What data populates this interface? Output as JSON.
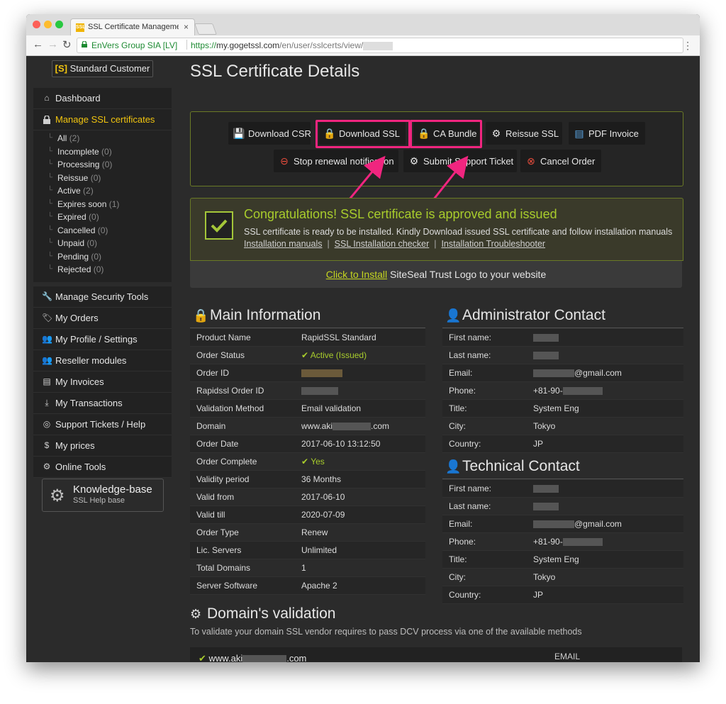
{
  "browser": {
    "tab_title": "SSL Certificate Management S",
    "tab_close": "×",
    "favicon": "SSL",
    "org": "EnVers Group SIA [LV]",
    "url_scheme": "https://",
    "url_host": "my.gogetssl.com",
    "url_path": "/en/user/sslcerts/view/",
    "back": "←",
    "forward": "→",
    "reload": "↻",
    "menu": "⋮"
  },
  "account": {
    "tag": "[S]",
    "label": "Standard Customer"
  },
  "sidebar": {
    "dashboard": "Dashboard",
    "manage_ssl": "Manage SSL certificates",
    "sub_items": [
      {
        "label": "All",
        "count": "(2)"
      },
      {
        "label": "Incomplete",
        "count": "(0)"
      },
      {
        "label": "Processing",
        "count": "(0)"
      },
      {
        "label": "Reissue",
        "count": "(0)"
      },
      {
        "label": "Active",
        "count": "(2)"
      },
      {
        "label": "Expires soon",
        "count": "(1)"
      },
      {
        "label": "Expired",
        "count": "(0)"
      },
      {
        "label": "Cancelled",
        "count": "(0)"
      },
      {
        "label": "Unpaid",
        "count": "(0)"
      },
      {
        "label": "Pending",
        "count": "(0)"
      },
      {
        "label": "Rejected",
        "count": "(0)"
      }
    ],
    "items": [
      {
        "label": "Manage Security Tools",
        "icon": "wrench-icon"
      },
      {
        "label": "My Orders",
        "icon": "tag-icon"
      },
      {
        "label": "My Profile / Settings",
        "icon": "users-icon"
      },
      {
        "label": "Reseller modules",
        "icon": "users-icon"
      },
      {
        "label": "My Invoices",
        "icon": "document-icon"
      },
      {
        "label": "My Transactions",
        "icon": "download-icon"
      },
      {
        "label": "Support Tickets / Help",
        "icon": "lifebuoy-icon"
      },
      {
        "label": "My prices",
        "icon": "dollar-icon"
      },
      {
        "label": "Online Tools",
        "icon": "gear-icon"
      }
    ],
    "kb_title": "Knowledge-base",
    "kb_sub": "SSL Help base"
  },
  "main": {
    "title": "SSL Certificate Details",
    "toolbar": {
      "download_csr": "Download CSR",
      "download_ssl": "Download SSL",
      "ca_bundle": "CA Bundle",
      "reissue_ssl": "Reissue SSL",
      "pdf_invoice": "PDF Invoice",
      "stop_renewal": "Stop renewal notification",
      "submit_ticket": "Submit Support Ticket",
      "cancel_order": "Cancel Order"
    },
    "congrats": {
      "title": "Congratulations! SSL certificate is approved and issued",
      "message": "SSL certificate is ready to be installed. Kindly Download issued SSL certificate and follow installation manuals",
      "link1": "Installation manuals",
      "link2": "SSL Installation checker",
      "link3": "Installation Troubleshooter",
      "sep": "|"
    },
    "siteseal": {
      "link": "Click to Install",
      "rest": " SiteSeal Trust Logo to your website"
    },
    "main_info": {
      "title": "Main Information",
      "rows": [
        {
          "k": "Product Name",
          "v": "RapidSSL Standard"
        },
        {
          "k": "Order Status",
          "v": "Active (Issued)"
        },
        {
          "k": "Order ID",
          "v": ""
        },
        {
          "k": "Rapidssl Order ID",
          "v": ""
        },
        {
          "k": "Validation Method",
          "v": "Email validation"
        },
        {
          "k": "Domain",
          "v": "www.aki"
        },
        {
          "k": "Order Date",
          "v": "2017-06-10 13:12:50"
        },
        {
          "k": "Order Complete",
          "v": "Yes"
        },
        {
          "k": "Validity period",
          "v": "36 Months"
        },
        {
          "k": "Valid from",
          "v": "2017-06-10"
        },
        {
          "k": "Valid till",
          "v": "2020-07-09"
        },
        {
          "k": "Order Type",
          "v": "Renew"
        },
        {
          "k": "Lic. Servers",
          "v": "Unlimited"
        },
        {
          "k": "Total Domains",
          "v": "1"
        },
        {
          "k": "Server Software",
          "v": "Apache 2"
        }
      ],
      "domain_suffix": ".com"
    },
    "admin": {
      "title": "Administrator Contact",
      "rows": [
        {
          "k": "First name:",
          "v": ""
        },
        {
          "k": "Last name:",
          "v": ""
        },
        {
          "k": "Email:",
          "v": "@gmail.com"
        },
        {
          "k": "Phone:",
          "v": "+81-90-"
        },
        {
          "k": "Title:",
          "v": "System Eng"
        },
        {
          "k": "City:",
          "v": "Tokyo"
        },
        {
          "k": "Country:",
          "v": "JP"
        }
      ]
    },
    "tech": {
      "title": "Technical Contact",
      "rows": [
        {
          "k": "First name:",
          "v": ""
        },
        {
          "k": "Last name:",
          "v": ""
        },
        {
          "k": "Email:",
          "v": "@gmail.com"
        },
        {
          "k": "Phone:",
          "v": "+81-90-"
        },
        {
          "k": "Title:",
          "v": "System Eng"
        },
        {
          "k": "City:",
          "v": "Tokyo"
        },
        {
          "k": "Country:",
          "v": "JP"
        }
      ]
    },
    "dcv": {
      "title": "Domain's validation",
      "desc": "To validate your domain SSL vendor requires to pass DCV process via one of the available methods",
      "domain_prefix": "www.aki",
      "domain_suffix": ".com",
      "method": "EMAIL"
    }
  },
  "colors": {
    "accent": "#f1c40f",
    "success": "#a8cc2c",
    "highlight": "#f0257f"
  }
}
